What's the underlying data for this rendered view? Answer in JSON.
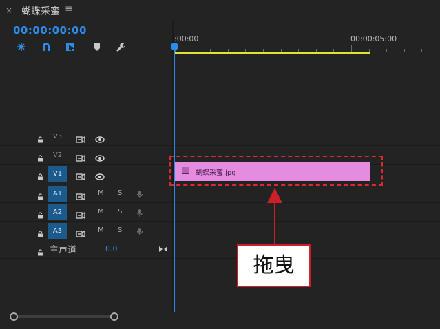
{
  "panel": {
    "tab_title": "蝴蝶采蜜",
    "close_glyph": "×",
    "menu_glyph": "≡"
  },
  "timecode": "00:00:00:00",
  "tools": [
    {
      "name": "nest-sequence-icon",
      "glyph": "⁂"
    },
    {
      "name": "snap-magnet-icon",
      "glyph": "∩"
    },
    {
      "name": "linked-selection-icon",
      "glyph": "◩"
    },
    {
      "name": "add-marker-icon",
      "glyph": "⬟"
    },
    {
      "name": "wrench-settings-icon",
      "glyph": "🔧"
    }
  ],
  "ruler": {
    "start_label": ":00:00",
    "mark_label": "00:00:05:00"
  },
  "video_tracks": [
    {
      "label": "V3",
      "active": false
    },
    {
      "label": "V2",
      "active": false
    },
    {
      "label": "V1",
      "active": true
    }
  ],
  "audio_tracks": [
    {
      "label": "A1",
      "active": true,
      "mute": "M",
      "solo": "S"
    },
    {
      "label": "A2",
      "active": true,
      "mute": "M",
      "solo": "S"
    },
    {
      "label": "A3",
      "active": true,
      "mute": "M",
      "solo": "S"
    }
  ],
  "master": {
    "label": "主声道",
    "value": "0.0"
  },
  "clip": {
    "label": "蝴蝶采蜜.jpg",
    "color": "#e38ce0"
  },
  "annotation": {
    "text": "拖曳",
    "color": "#cc1f27"
  },
  "colors": {
    "accent": "#2d8ceb",
    "work_area": "#e3e036",
    "track_active": "#1d5a8c"
  }
}
